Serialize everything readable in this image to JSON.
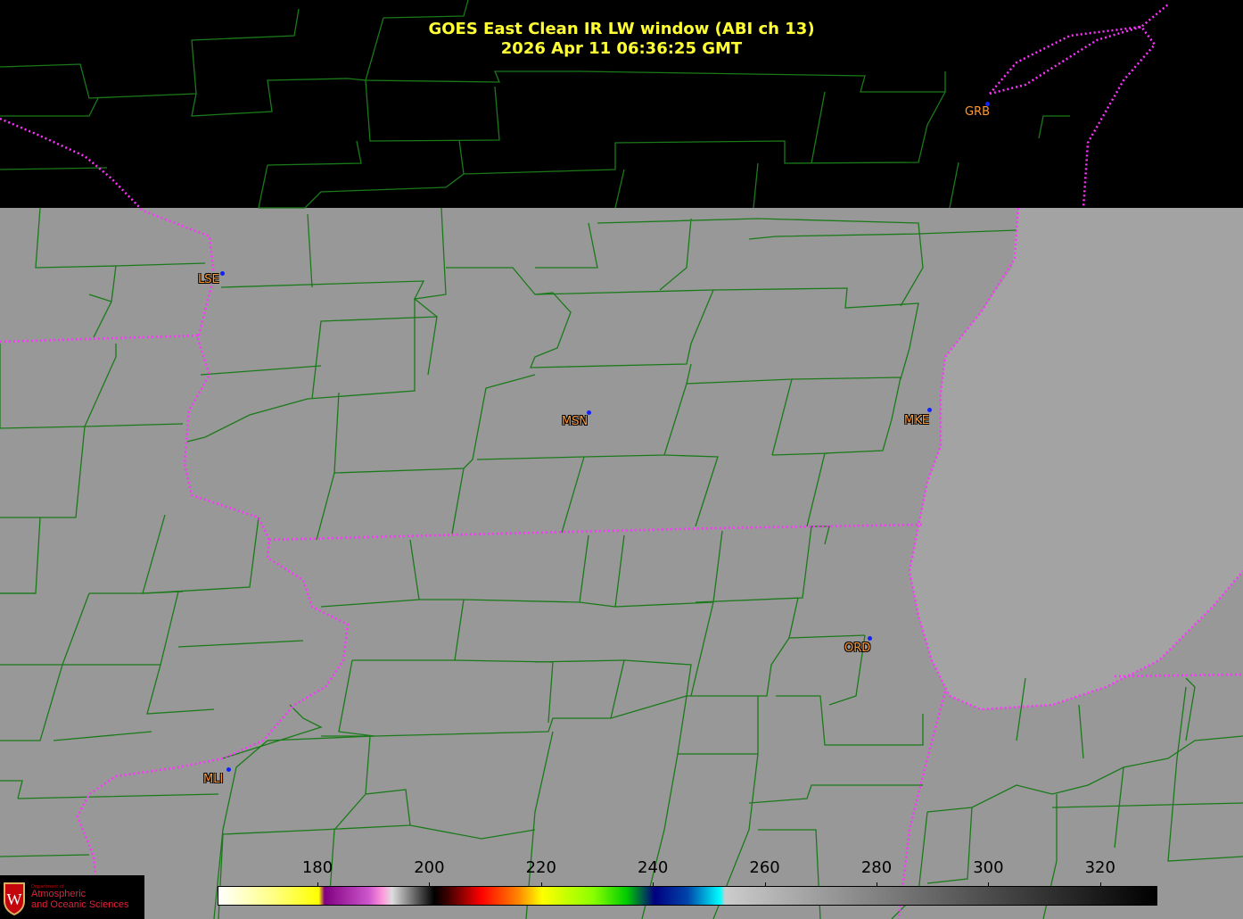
{
  "title": {
    "line1": "GOES East Clean IR LW window (ABI ch 13)",
    "line2": "2026 Apr 11  06:36:25 GMT"
  },
  "stations": [
    {
      "id": "LSE",
      "label": "LSE"
    },
    {
      "id": "MSN",
      "label": "MSN"
    },
    {
      "id": "MKE",
      "label": "MKE"
    },
    {
      "id": "ORD",
      "label": "ORD"
    },
    {
      "id": "MLI",
      "label": "MLI"
    },
    {
      "id": "GRB",
      "label": "GRB"
    }
  ],
  "colorbar": {
    "ticks": [
      "180",
      "200",
      "220",
      "240",
      "260",
      "280",
      "300",
      "320"
    ]
  },
  "logo": {
    "dept": "Department of",
    "name_line1": "Atmospheric",
    "name_line2": "and Oceanic Sciences",
    "shield_letter": "W"
  },
  "colors": {
    "title": "#ffff33",
    "county_lines": "#1a7a1a",
    "state_borders": "#ff33ff",
    "station_label": "#ff9933",
    "station_dot": "#1020ff",
    "cloud_free_gray": "#989898",
    "lake_gray": "#a4a4a4"
  }
}
